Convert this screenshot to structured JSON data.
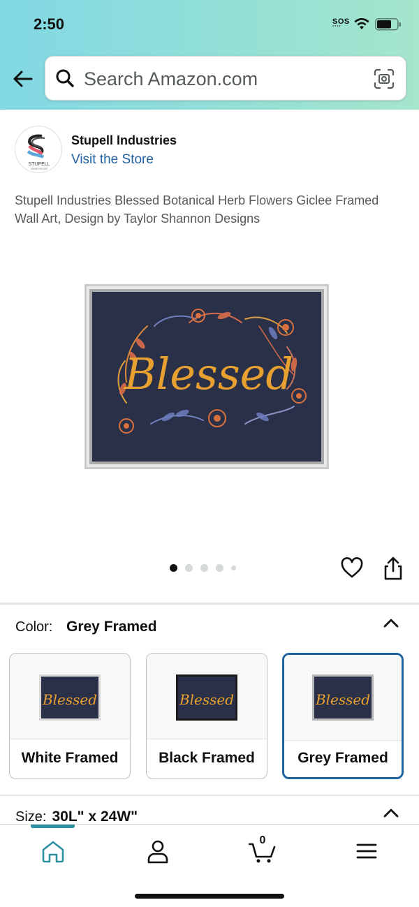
{
  "status_bar": {
    "time": "2:50",
    "sos": "SOS"
  },
  "header": {
    "search_placeholder": "Search Amazon.com",
    "accent_color": "#81d8e4"
  },
  "brand": {
    "name": "Stupell Industries",
    "store_link": "Visit the Store",
    "logo_text": "STUPELL",
    "logo_subtext": "HOME DECOR"
  },
  "product": {
    "title": "Stupell Industries Blessed Botanical Herb Flowers Giclee Framed Wall Art, Design by Taylor Shannon Designs",
    "image_text": "Blessed",
    "carousel": {
      "count": 5,
      "active_index": 0
    }
  },
  "color_selector": {
    "label": "Color:",
    "value": "Grey Framed",
    "options": [
      {
        "label": "White Framed",
        "selected": false
      },
      {
        "label": "Black Framed",
        "selected": false
      },
      {
        "label": "Grey Framed",
        "selected": true
      }
    ],
    "selected_border_color": "#2162a1"
  },
  "size_selector": {
    "label": "Size:",
    "value": "30L\" x 24W\""
  },
  "bottom_nav": {
    "items": [
      "home-icon",
      "account-icon",
      "cart-icon",
      "menu-icon"
    ],
    "cart_count": "0",
    "active_color": "#2e8fa0"
  }
}
